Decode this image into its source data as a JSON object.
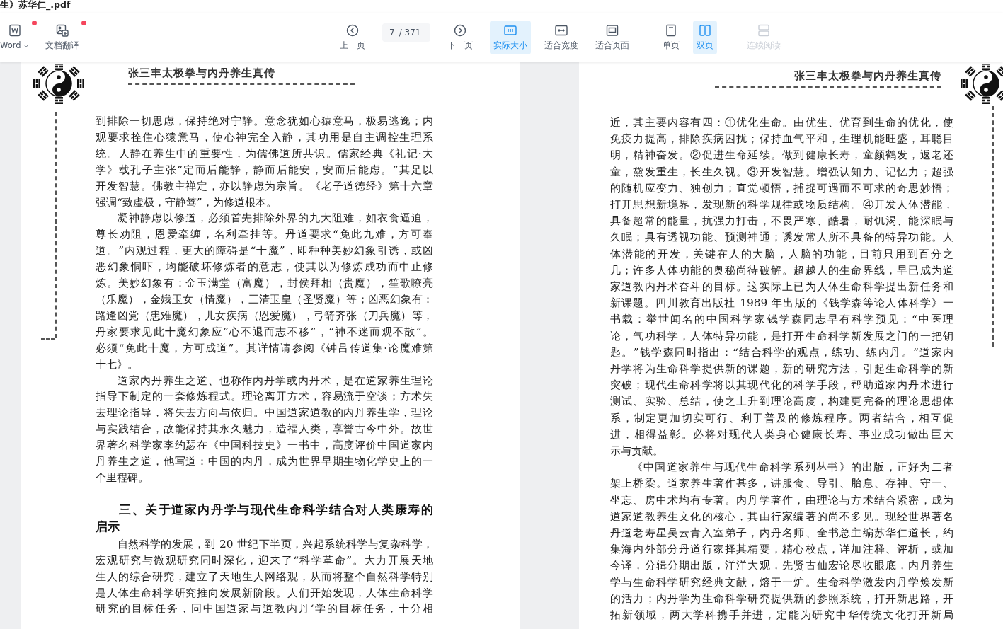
{
  "window": {
    "title": "生》苏华仁_.pdf"
  },
  "toolbar": {
    "left_tools": [
      {
        "kind": "word",
        "label": "Word",
        "notification": true,
        "dropdown": true
      },
      {
        "kind": "translate",
        "label": "文档翻译",
        "notification": true,
        "dropdown": false
      }
    ],
    "prev": {
      "kind": "prev",
      "label": "上一页"
    },
    "page_field": {
      "value": "7",
      "total": "/ 371"
    },
    "next": {
      "kind": "next",
      "label": "下一页"
    },
    "view_groups": [
      [
        {
          "kind": "actual-size",
          "label": "实际大小",
          "selected": true,
          "disabled": false
        },
        {
          "kind": "fit-width",
          "label": "适合宽度",
          "selected": false,
          "disabled": false
        },
        {
          "kind": "fit-page",
          "label": "适合页面",
          "selected": false,
          "disabled": false
        }
      ],
      [
        {
          "kind": "single",
          "label": "单页",
          "selected": false,
          "disabled": false
        },
        {
          "kind": "double",
          "label": "双页",
          "selected": true,
          "disabled": false
        }
      ],
      [
        {
          "kind": "continuous",
          "label": "连续阅读",
          "selected": false,
          "disabled": true
        }
      ]
    ]
  },
  "pages": [
    {
      "kind": "left-page",
      "header": "张三丰太极拳与内丹养生真传",
      "blocks": [
        {
          "kind": "continued",
          "ends": true,
          "lines": [
            "到排除一切思虑，保持绝对宁静。意念犹如心猿意马，极易逃逸；内",
            "观要求拴住心猿意马，使心神完全入静，其功用是自主调控生理系",
            "统。人静在养生中的重要性，为儒佛道所共识。儒家经典《礼记·大",
            "学》载孔子主张“定而后能静，静而后能安，安而后能虑。”其足以",
            "开发智慧。佛教主禅定，亦以静虑为宗旨。《老子道德经》第十六章",
            "强调“致虚极，守静笃”，为修道根本。"
          ]
        },
        {
          "kind": "paragraph",
          "ends": true,
          "lines": [
            "凝神静虑以修道，必须首先排除外界的九大阻难，如衣食逼迫，",
            "尊长劝阻，恩爱牵缠，名利牵挂等。丹道要求“免此九难，方可奉",
            "道。”内观过程，更大的障碍是“十魔”，即种种美妙幻象引诱，或凶",
            "恶幻象恫吓，均能破坏修炼者的意志，使其以为修炼成功而中止修",
            "炼。美妙幻象有：金玉满堂（富魔），封侯拜相（贵魔），笙歌嘹亮",
            "（乐魔），金娥玉女（情魔），三清玉皇（圣贤魔）等；凶恶幻象有：",
            "路逢凶党（患难魔），儿女疾病（恩爱魔），弓箭齐张（刀兵魔）等，",
            "丹家要求见此十魔幻象应“心不退而志不移”，“神不迷而观不散”。",
            "必须“免此十魔，方可成道”。其详情请参阅《钟吕传道集·论魔难第",
            "十七》。"
          ]
        },
        {
          "kind": "paragraph",
          "ends": true,
          "lines": [
            "道家内丹养生之道、也称作内丹学或内丹术，是在道家养生理论",
            "指导下制定的一套修炼程式。理论离开方术，容易流于空谈；方术失",
            "去理论指导，将失去方向与依归。中国道家道教的内丹养生学，理论",
            "与实践结合，故能保持其永久魅力，造福人类，享誉古今中外。故世",
            "界著名科学家李约瑟在《中国科技史》一书中，高度评价中国道家内",
            "丹养生之道，他写道：中国的内丹，成为世界早期生物化学史上的一",
            "个里程碑。"
          ]
        },
        {
          "kind": "heading",
          "ends": true,
          "lines": [
            "三、关于道家内丹学与现代生命科学结合对人类康寿的",
            "启示"
          ]
        },
        {
          "kind": "paragraph",
          "ends": false,
          "lines": [
            "自然科学的发展，到 20 世纪下半页，兴起系统科学与复杂科学，",
            "宏观研究与微观研究同时深化，迎来了“科学革命”。大力开展天地",
            "生人的综合研究，建立了天地生人网络观，从而将整个自然科学特别",
            "是人体生命科学研究推向发展新阶段。人们开始发现，人体生命科学",
            "研究的目标任务，同中国道家与道教内丹‘学的目标任务，十分相"
          ]
        }
      ]
    },
    {
      "kind": "right-page",
      "header": "张三丰太极拳与内丹养生真传",
      "blocks": [
        {
          "kind": "continued",
          "ends": true,
          "lines": [
            "近，其主要内容有四：①优化生命。由优生、优育到生命的优化，使",
            "免疫力提高，排除疾病困扰；保持血气平和，生理机能旺盛，耳聪目",
            "明，精神奋发。②促进生命延续。做到健康长寿，童颜鹤发，返老还",
            "童，黛发重生，长生久视。③开发智慧。增强认知力、记忆力；超强",
            "的随机应变力、独创力；直觉顿悟，捕捉可遇而不可求的奇思妙悟；",
            "打开思想新境界，发现新的科学规律或物质结构。④开发人体潜能，",
            "具备超常的能量，抗强力打击，不畏严寒、酷暑，耐饥渴、能深眠与",
            "久眠；具有透视功能、预测神通；诱发常人所不具备的特异功能。人",
            "体潜能的开发，关键在人的大脑，人脑的功能，目前只用到百分之",
            "几；许多人体功能的奥秘尚待破解。超越人的生命界线，早已成为道",
            "家道教内丹术奋斗的目标。这实际上已为人体生命科学提出新任务和",
            "新课题。四川教育出版社 1989 年出版的《钱学森等论人体科学》一",
            "书载：举世闻名的中国科学家钱学森同志早有科学预见：“中医理",
            "论，气功科学，人体特异功能，是打开生命科学新发展之门的一把钥",
            "匙。”钱学森同时指出：“结合科学的观点，练功、练内丹。”道家内",
            "丹学将为生命科学提供新的课题，新的研究方法，引起生命科学的新",
            "突破；现代生命科学将以其现代化的科学手段，帮助道家内丹术进行",
            "测试、实验、总结，使之上升到理论高度，构建更完备的理论思想体",
            "系，制定更加切实可行、利于普及的修炼程序。两者结合，相互促",
            "进，相得益彰。必将对现代人类身心健康长寿、事业成功做出巨大",
            "示与贡献。"
          ]
        },
        {
          "kind": "paragraph",
          "ends": false,
          "lines": [
            "《中国道家养生与现代生命科学系列丛书》的出版，正好为二者",
            "架上桥梁。道家养生著作甚多，讲服食、导引、胎息、存神、守一、",
            "坐忘、房中术均有专著。内丹学著作，由理论与方术结合紧密，成为",
            "道家道教养生文化的核心，其由行家编著的尚不多见。现经世界著名",
            "丹道老寿星吴云青入室弟子，内丹名师、全书总主编苏华仁道长，约",
            "集海内外部分丹道行家择其精要，精心校点，详加注释、评析，或加",
            "今译，分辑分期出版，洋洋大观，先贤古仙宏论尽收眼底，内丹养生",
            "学与生命科学研究经典文献，熔于一炉。生命科学激发内丹学焕发新",
            "的活力；内丹学为生命科学研究提供新的参照系统，打开新思路，开",
            "拓新领域，两大学科携手并进，定能为研究中华传统文化打开新局"
          ]
        }
      ]
    }
  ]
}
